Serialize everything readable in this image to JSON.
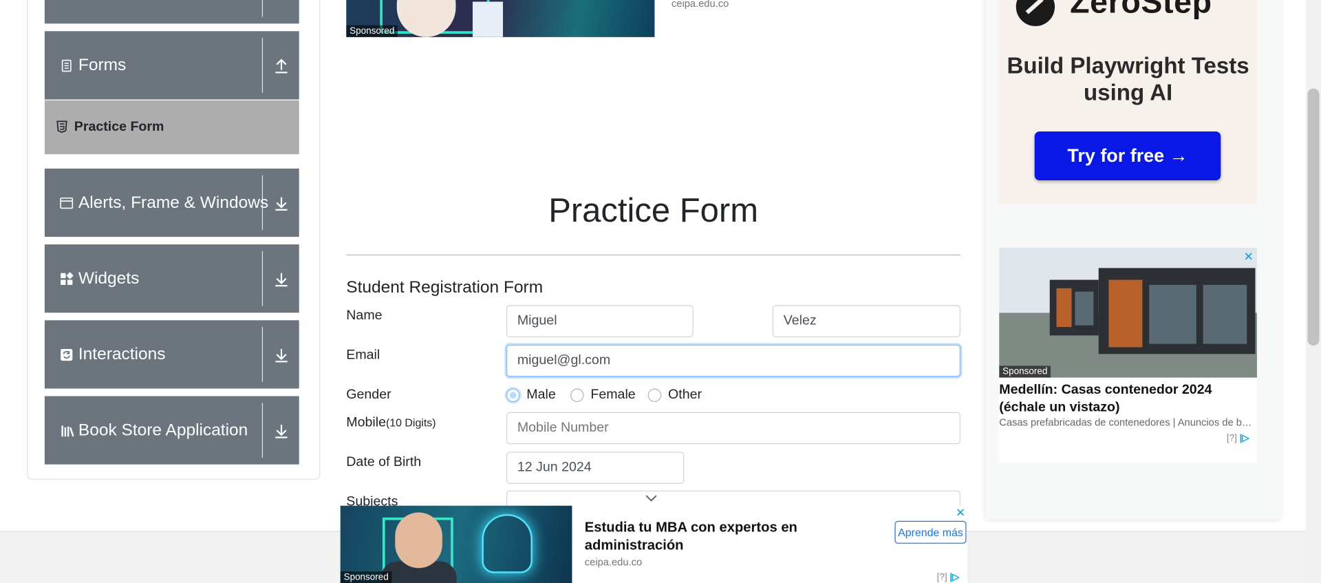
{
  "sidebar": {
    "groups": [
      {
        "label": "Forms",
        "icon": "form-icon",
        "toggle": "collapse-arrow-icon"
      },
      {
        "label": "Alerts, Frame & Windows",
        "icon": "window-icon",
        "toggle": "expand-arrow-icon"
      },
      {
        "label": "Widgets",
        "icon": "widgets-icon",
        "toggle": "expand-arrow-icon"
      },
      {
        "label": "Interactions",
        "icon": "interactions-icon",
        "toggle": "expand-arrow-icon"
      },
      {
        "label": "Book Store Application",
        "icon": "books-icon",
        "toggle": "expand-arrow-icon"
      }
    ],
    "active_item": {
      "label": "Practice Form",
      "icon": "html5-icon"
    }
  },
  "top_ad": {
    "sponsored": "Sponsored",
    "domain": "ceipa.edu.co"
  },
  "main": {
    "title": "Practice Form",
    "form_title": "Student Registration Form",
    "name": {
      "label": "Name",
      "first_value": "Miguel",
      "last_value": "Velez"
    },
    "email": {
      "label": "Email",
      "value": "miguel@gl.com"
    },
    "gender": {
      "label": "Gender",
      "options": [
        "Male",
        "Female",
        "Other"
      ],
      "selected": "Male"
    },
    "mobile": {
      "label": "Mobile",
      "hint": "(10 Digits)",
      "placeholder": "Mobile Number"
    },
    "dob": {
      "label": "Date of Birth",
      "value": "12 Jun 2024"
    },
    "subjects": {
      "label": "Subjects"
    }
  },
  "right_ads": {
    "zerostep": {
      "logo_text": "ZeroStep",
      "headline": "Build Playwright Tests using AI",
      "cta": "Try for free →"
    },
    "house": {
      "sponsored": "Sponsored",
      "title": "Medellín: Casas contenedor 2024 (échale un vistazo)",
      "subtitle": "Casas prefabricadas de contenedores | Anuncios de b…",
      "adchoices": "[?]",
      "close": "✕"
    }
  },
  "bottom_ad": {
    "sponsored": "Sponsored",
    "title": "Estudia tu MBA con expertos en administración",
    "domain": "ceipa.edu.co",
    "cta": "Aprende más",
    "adchoices": "[?]",
    "close": "✕"
  },
  "colors": {
    "sidebar_group_bg": "#6c757d",
    "active_item_bg": "#adadad",
    "cta_blue": "#0a18e6",
    "link_blue": "#1a73e8",
    "focus_border": "#80bdff"
  }
}
